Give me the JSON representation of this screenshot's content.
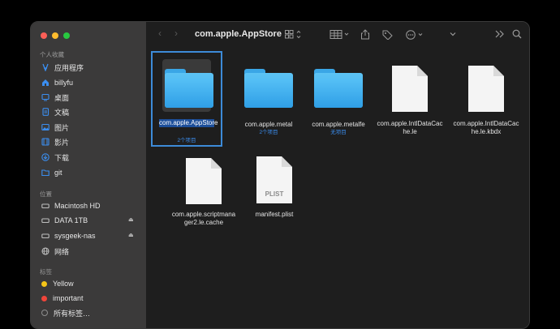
{
  "window": {
    "title": "com.apple.AppStore"
  },
  "sidebar": {
    "favorites_header": "个人收藏",
    "favorites": [
      {
        "label": "应用程序",
        "icon": "apps-icon"
      },
      {
        "label": "billyfu",
        "icon": "home-icon"
      },
      {
        "label": "桌面",
        "icon": "desktop-icon"
      },
      {
        "label": "文稿",
        "icon": "document-icon"
      },
      {
        "label": "图片",
        "icon": "photo-icon"
      },
      {
        "label": "影片",
        "icon": "film-icon"
      },
      {
        "label": "下载",
        "icon": "download-icon"
      },
      {
        "label": "git",
        "icon": "folder-icon"
      }
    ],
    "locations_header": "位置",
    "locations": [
      {
        "label": "Macintosh HD",
        "icon": "drive-icon",
        "eject": false
      },
      {
        "label": "DATA 1TB",
        "icon": "drive-icon",
        "eject": true
      },
      {
        "label": "sysgeek-nas",
        "icon": "drive-icon",
        "eject": true
      },
      {
        "label": "网络",
        "icon": "network-icon",
        "eject": false
      }
    ],
    "tags_header": "标签",
    "tags": [
      {
        "label": "Yellow",
        "color": "#f5c518"
      },
      {
        "label": "important",
        "color": "#f0453a"
      },
      {
        "label": "所有标签…",
        "color": "#8e8e8e"
      }
    ]
  },
  "files": [
    {
      "name": "com.apple.AppStore",
      "sub": "2个项目",
      "kind": "folder",
      "selected": true
    },
    {
      "name": "com.apple.metal",
      "sub": "2个项目",
      "kind": "folder",
      "selected": false
    },
    {
      "name": "com.apple.metalfe",
      "sub": "无项目",
      "kind": "folder",
      "selected": false
    },
    {
      "name": "com.apple.IntlDataCache.le",
      "sub": "",
      "kind": "doc",
      "selected": false
    },
    {
      "name": "com.apple.IntlDataCache.le.kbdx",
      "sub": "",
      "kind": "doc",
      "selected": false
    },
    {
      "name": "com.apple.scriptmanager2.le.cache",
      "sub": "",
      "kind": "doc",
      "selected": false
    },
    {
      "name": "manifest.plist",
      "sub": "",
      "kind": "plist",
      "doc_label": "PLIST",
      "selected": false
    }
  ],
  "colors": {
    "accent": "#3b8ef0",
    "folder": "#3aa9e8",
    "selection": "#1d4f9a"
  }
}
